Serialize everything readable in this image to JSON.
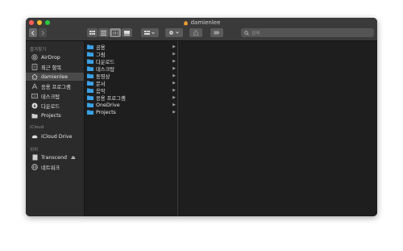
{
  "window": {
    "title": "damienlee"
  },
  "toolbar": {
    "back": "back",
    "forward": "forward",
    "search_placeholder": "검색"
  },
  "sidebar": {
    "favorites_header": "즐겨찾기",
    "favorites": [
      {
        "label": "AirDrop",
        "icon": "airdrop-icon"
      },
      {
        "label": "최근 항목",
        "icon": "recents-icon"
      },
      {
        "label": "damienlee",
        "icon": "home-icon",
        "selected": true
      },
      {
        "label": "응용 프로그램",
        "icon": "applications-icon"
      },
      {
        "label": "데스크탑",
        "icon": "desktop-icon"
      },
      {
        "label": "다운로드",
        "icon": "downloads-icon"
      },
      {
        "label": "Projects",
        "icon": "folder-icon"
      }
    ],
    "icloud_header": "iCloud",
    "icloud": [
      {
        "label": "iCloud Drive",
        "icon": "cloud-icon"
      }
    ],
    "locations_header": "위치",
    "locations": [
      {
        "label": "Transcend",
        "icon": "drive-icon",
        "eject": "⏏"
      },
      {
        "label": "네트워크",
        "icon": "network-icon"
      }
    ]
  },
  "column1": {
    "items": [
      {
        "label": "공용"
      },
      {
        "label": "그림"
      },
      {
        "label": "다운로드"
      },
      {
        "label": "데스크탑"
      },
      {
        "label": "동영상"
      },
      {
        "label": "문서"
      },
      {
        "label": "음악"
      },
      {
        "label": "응용 프로그램"
      },
      {
        "label": "OneDrive"
      },
      {
        "label": "Projects"
      }
    ],
    "chevron": "▶"
  },
  "colors": {
    "window_bg": "#1e1e1e",
    "sidebar_bg": "#2b2b2b",
    "titlebar_bg": "#3a3a3a",
    "selected_bg": "#4a4a4a",
    "folder_blue": "#3ba2e8"
  }
}
